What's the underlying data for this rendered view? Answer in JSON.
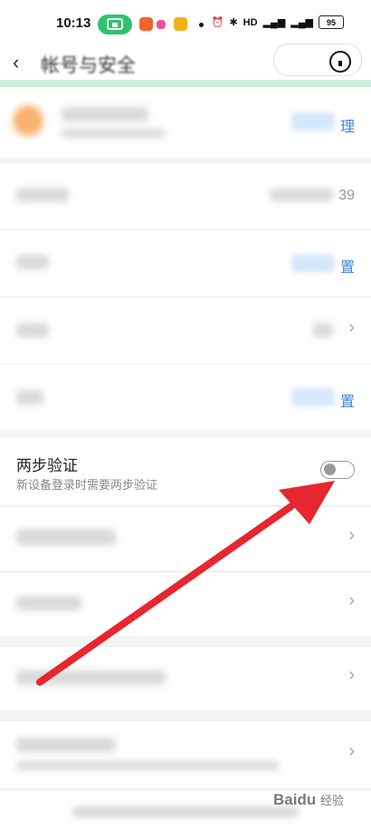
{
  "status_bar": {
    "time": "10:13",
    "battery": "95"
  },
  "header": {
    "title": "帐号与安全"
  },
  "rows": [
    {
      "action": "理"
    },
    {
      "value": "39"
    },
    {
      "action": "置"
    },
    {
      "action": "置"
    }
  ],
  "two_step": {
    "title": "两步验证",
    "subtitle": "新设备登录时需要两步验证",
    "enabled": false
  },
  "watermark": {
    "text": "Baidu",
    "sub": "经验"
  },
  "colors": {
    "link": "#3d86e6",
    "accent_green": "#2fc36b",
    "arrow": "#e8262f"
  }
}
